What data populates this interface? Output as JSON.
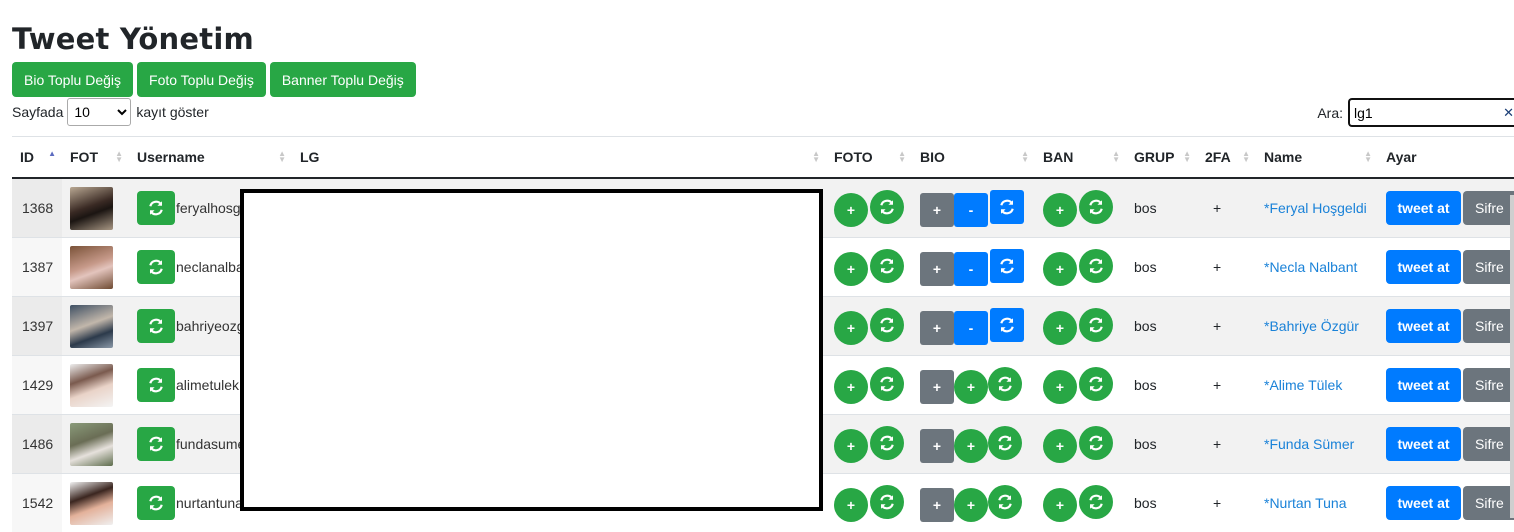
{
  "page": {
    "title": "Tweet Yönetim",
    "buttons": {
      "bio_bulk": "Bio Toplu Değiş",
      "foto_bulk": "Foto Toplu Değiş",
      "banner_bulk": "Banner Toplu Değiş"
    }
  },
  "length": {
    "prefix": "Sayfada",
    "value": "10",
    "options": [
      "10"
    ],
    "suffix": "kayıt göster"
  },
  "search": {
    "label": "Ara:",
    "value": "lg1",
    "clear_glyph": "✕"
  },
  "table": {
    "headers": {
      "id": "ID",
      "fot": "FOT",
      "username": "Username",
      "lg": "LG",
      "foto": "FOTO",
      "bio": "BIO",
      "ban": "BAN",
      "grup": "GRUP",
      "twofa": "2FA",
      "name": "Name",
      "ayar": "Ayar"
    },
    "button_labels": {
      "plus": "+",
      "minus": "-",
      "tweet": "tweet at",
      "sifre": "Sifre"
    },
    "rows": [
      {
        "id": "1368",
        "username": "feryalhosge",
        "grup": "bos",
        "twofa": "+",
        "name": "*Feryal Hoşgeldi",
        "bio_variant": "minus"
      },
      {
        "id": "1387",
        "username": "neclanalbar",
        "grup": "bos",
        "twofa": "+",
        "name": "*Necla Nalbant",
        "bio_variant": "minus"
      },
      {
        "id": "1397",
        "username": "bahriyeozgi",
        "grup": "bos",
        "twofa": "+",
        "name": "*Bahriye Özgür",
        "bio_variant": "minus"
      },
      {
        "id": "1429",
        "username": "alimetulek1",
        "grup": "bos",
        "twofa": "+",
        "name": "*Alime Tülek",
        "bio_variant": "plus"
      },
      {
        "id": "1486",
        "username": "fundasume",
        "grup": "bos",
        "twofa": "+",
        "name": "*Funda Sümer",
        "bio_variant": "plus"
      },
      {
        "id": "1542",
        "username": "nurtantuna",
        "grup": "bos",
        "twofa": "+",
        "name": "*Nurtan Tuna",
        "bio_variant": "plus"
      }
    ]
  },
  "icons": {
    "refresh": "refresh-icon",
    "sort": "sort-icon"
  },
  "colors": {
    "success": "#28a745",
    "primary": "#007bff",
    "secondary": "#6c757d",
    "link": "#1a82d8"
  }
}
